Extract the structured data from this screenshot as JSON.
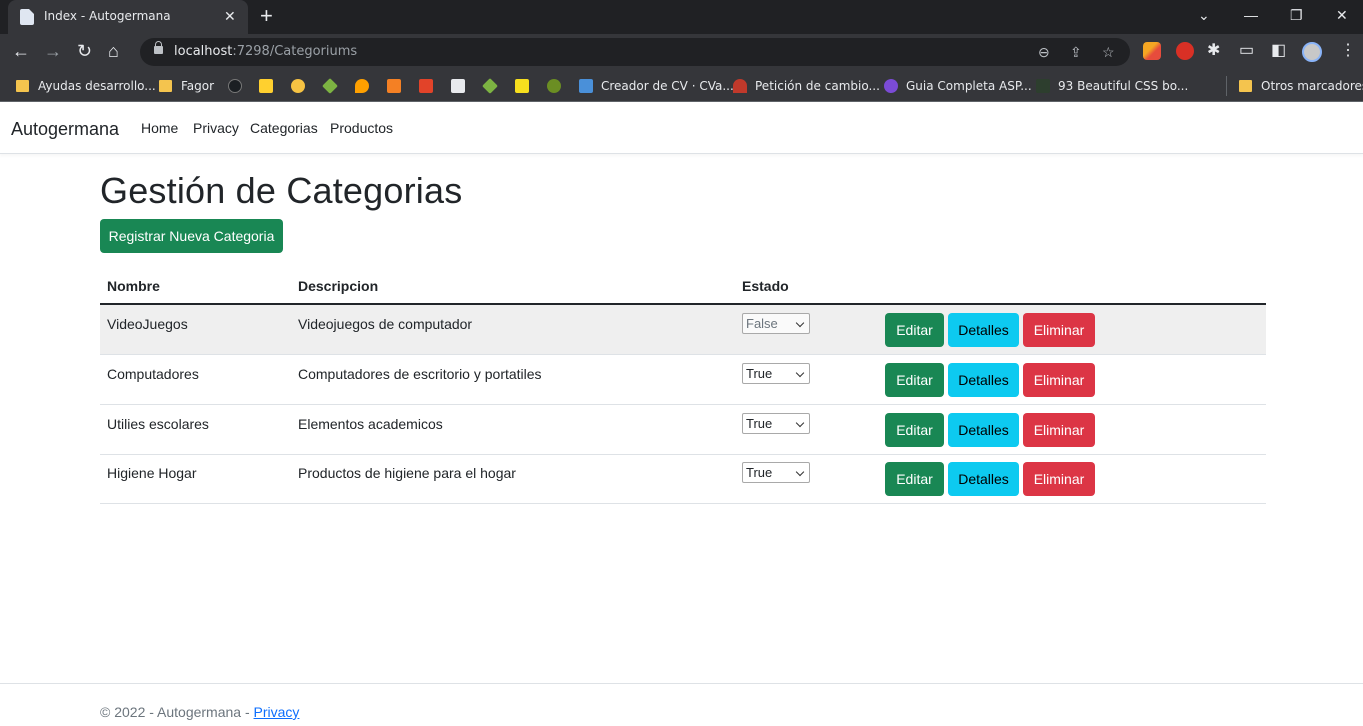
{
  "browser": {
    "tab_title": "Index - Autogermana",
    "tab_close": "✕",
    "new_tab": "+",
    "window_controls": [
      "⌄",
      "—",
      "❐",
      "✕"
    ],
    "url_host": "localhost",
    "url_path": ":7298/Categoriums",
    "bookmarks": [
      {
        "label": "Ayudas desarrollo...",
        "icon": "folder-icon"
      },
      {
        "label": "Fagor",
        "icon": "folder-icon"
      },
      {
        "label": "Creador de CV · CVa...",
        "icon": "cv-site-icon"
      },
      {
        "label": "Petición de cambio...",
        "icon": "request-site-icon"
      },
      {
        "label": "Guia Completa ASP...",
        "icon": "guide-site-icon"
      },
      {
        "label": "93 Beautiful CSS bo...",
        "icon": "css-site-icon"
      }
    ],
    "other_bookmarks": "Otros marcadores",
    "colors": {
      "frame": "#202124",
      "toolbar": "#35363a"
    }
  },
  "site": {
    "brand": "Autogermana",
    "nav": [
      "Home",
      "Privacy",
      "Categorias",
      "Productos"
    ]
  },
  "main": {
    "title": "Gestión de Categorias",
    "new_button": "Registrar Nueva Categoria",
    "columns": [
      "Nombre",
      "Descripcion",
      "Estado"
    ],
    "rows": [
      {
        "nombre": "VideoJuegos",
        "descripcion": "Videojuegos de computador",
        "estado": "False"
      },
      {
        "nombre": "Computadores",
        "descripcion": "Computadores de escritorio y portatiles",
        "estado": "True"
      },
      {
        "nombre": "Utilies escolares",
        "descripcion": "Elementos academicos",
        "estado": "True"
      },
      {
        "nombre": "Higiene Hogar",
        "descripcion": "Productos de higiene para el hogar",
        "estado": "True"
      }
    ],
    "actions": {
      "edit": "Editar",
      "details": "Detalles",
      "delete": "Eliminar"
    },
    "colors": {
      "success": "#198754",
      "info": "#0dcaf0",
      "danger": "#dc3545"
    }
  },
  "footer": {
    "text": "© 2022 - Autogermana - ",
    "link": "Privacy"
  }
}
